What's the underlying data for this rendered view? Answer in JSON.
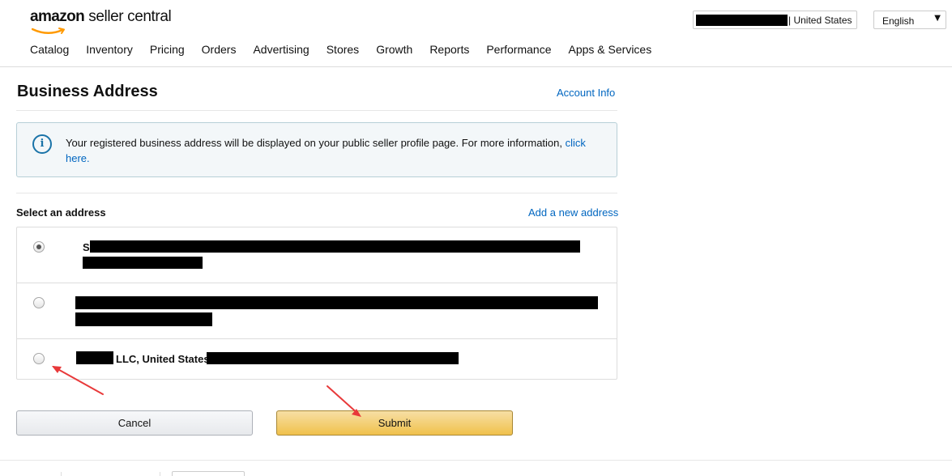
{
  "header": {
    "logo_brand": "amazon",
    "logo_product": "seller central",
    "account_country": "| United States",
    "language": "English",
    "nav": [
      "Catalog",
      "Inventory",
      "Pricing",
      "Orders",
      "Advertising",
      "Stores",
      "Growth",
      "Reports",
      "Performance",
      "Apps & Services"
    ]
  },
  "page": {
    "title": "Business Address",
    "account_info_link": "Account Info",
    "info_message": "Your registered business address will be displayed on your public seller profile page. For more information, ",
    "info_link": "click here.",
    "select_label": "Select an address",
    "add_address_link": "Add a new address"
  },
  "addresses": [
    {
      "visible_text": "S",
      "selected": true
    },
    {
      "visible_text": "",
      "selected": false
    },
    {
      "visible_text": "LLC, United States",
      "selected": false
    }
  ],
  "buttons": {
    "cancel": "Cancel",
    "submit": "Submit"
  },
  "colors": {
    "link": "#0066c0",
    "submit_button": "#f0c14b",
    "annotation_arrow": "#e8393a",
    "info_border": "#b7cfd7"
  },
  "icons": {
    "info": "info-circle-icon",
    "language_dropdown": "caret-down-icon"
  }
}
